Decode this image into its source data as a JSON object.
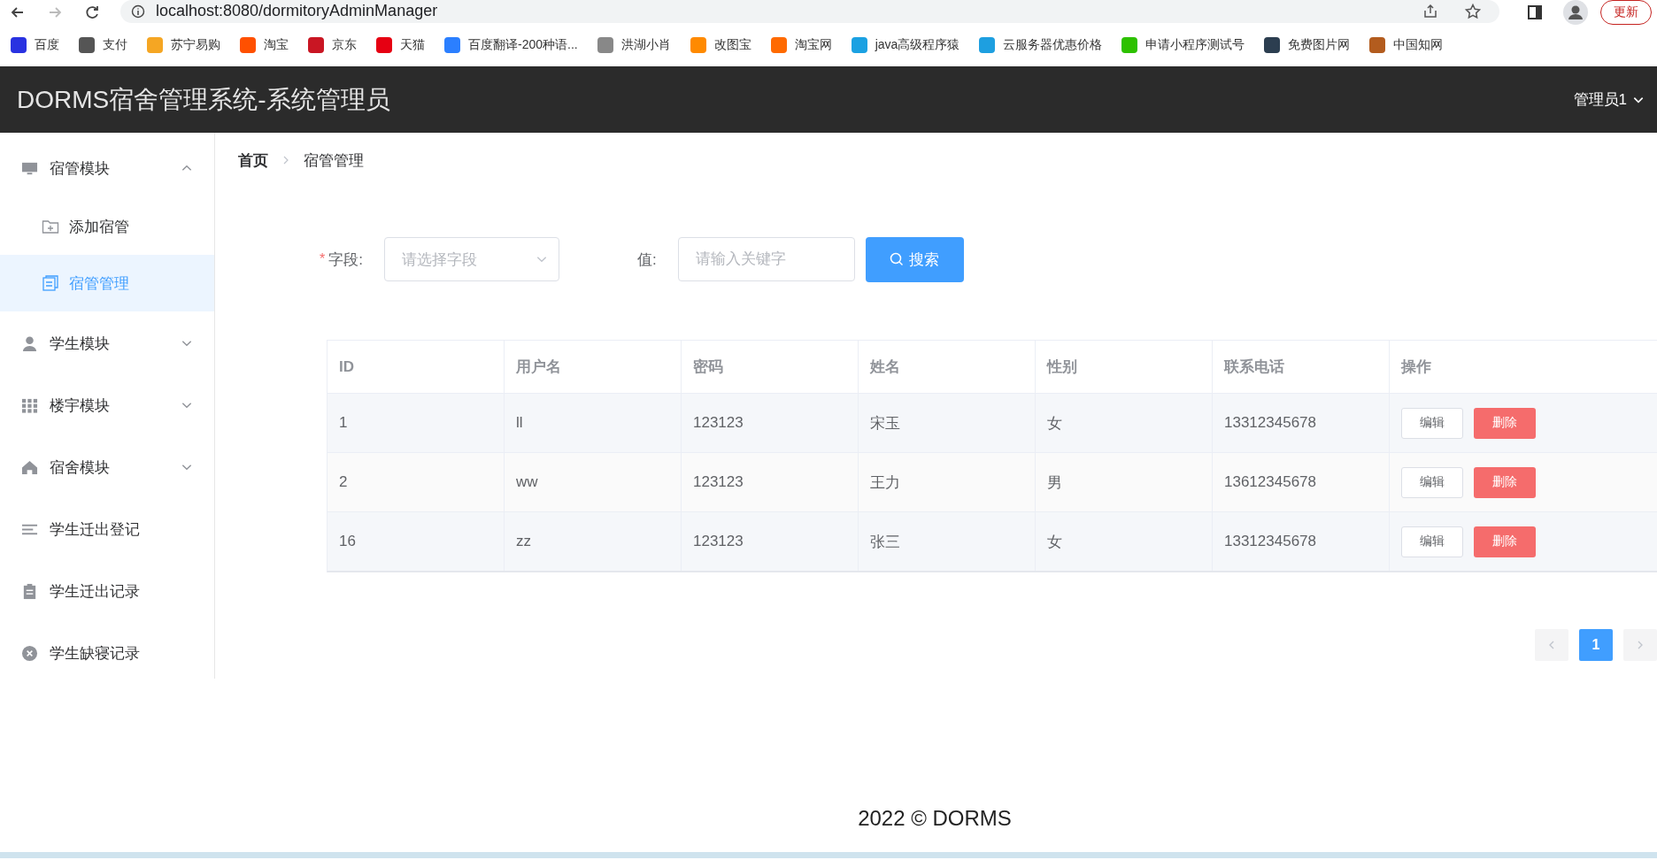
{
  "browser": {
    "url": "localhost:8080/dormitoryAdminManager",
    "update_button": "更新",
    "bookmarks": [
      {
        "label": "百度",
        "color": "#2932e1"
      },
      {
        "label": "支付",
        "color": "#555555"
      },
      {
        "label": "苏宁易购",
        "color": "#f5a623"
      },
      {
        "label": "淘宝",
        "color": "#ff5000"
      },
      {
        "label": "京东",
        "color": "#c91623"
      },
      {
        "label": "天猫",
        "color": "#e60012"
      },
      {
        "label": "百度翻译-200种语...",
        "color": "#2b7fff"
      },
      {
        "label": "洪湖小肖",
        "color": "#888888"
      },
      {
        "label": "改图宝",
        "color": "#ff8a00"
      },
      {
        "label": "淘宝网",
        "color": "#ff6a00"
      },
      {
        "label": "java高级程序猿",
        "color": "#1ba1e2"
      },
      {
        "label": "云服务器优惠价格",
        "color": "#1e9fe0"
      },
      {
        "label": "申请小程序测试号",
        "color": "#2dc100"
      },
      {
        "label": "免费图片网",
        "color": "#2c3e50"
      },
      {
        "label": "中国知网",
        "color": "#b35c1e"
      }
    ]
  },
  "header": {
    "title": "DORMS宿舍管理系统-系统管理员",
    "user_menu": "管理员1"
  },
  "sidebar": {
    "items": [
      {
        "label": "宿管模块",
        "kind": "submenu",
        "expanded": true,
        "children": [
          {
            "label": "添加宿管",
            "selected": false
          },
          {
            "label": "宿管管理",
            "selected": true
          }
        ]
      },
      {
        "label": "学生模块",
        "kind": "submenu",
        "expanded": false
      },
      {
        "label": "楼宇模块",
        "kind": "submenu",
        "expanded": false
      },
      {
        "label": "宿舍模块",
        "kind": "submenu",
        "expanded": false
      },
      {
        "label": "学生迁出登记",
        "kind": "item"
      },
      {
        "label": "学生迁出记录",
        "kind": "item"
      },
      {
        "label": "学生缺寝记录",
        "kind": "item"
      }
    ]
  },
  "breadcrumb": [
    "首页",
    "宿管管理"
  ],
  "search_form": {
    "required_mark": "*",
    "field_label": "字段:",
    "field_placeholder": "请选择字段",
    "value_label": "值:",
    "value_placeholder": "请输入关键字",
    "search_button": "搜索"
  },
  "table": {
    "columns": [
      "ID",
      "用户名",
      "密码",
      "姓名",
      "性别",
      "联系电话",
      "操作"
    ],
    "rows": [
      {
        "cells": [
          "1",
          "ll",
          "123123",
          "宋玉",
          "女",
          "13312345678"
        ],
        "edit": "编辑",
        "delete": "删除"
      },
      {
        "cells": [
          "2",
          "ww",
          "123123",
          "王力",
          "男",
          "13612345678"
        ],
        "edit": "编辑",
        "delete": "删除"
      },
      {
        "cells": [
          "16",
          "zz",
          "123123",
          "张三",
          "女",
          "13312345678"
        ],
        "edit": "编辑",
        "delete": "删除"
      }
    ]
  },
  "pagination": {
    "pages": [
      {
        "label": "1",
        "selected": true
      }
    ]
  },
  "footer": "2022 © DORMS"
}
